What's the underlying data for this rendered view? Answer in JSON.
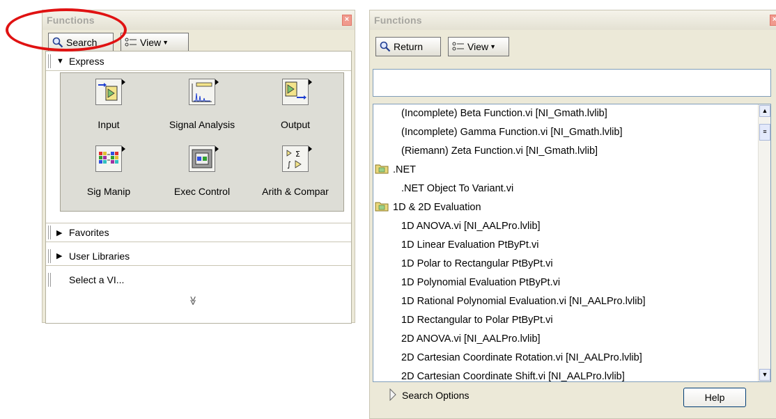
{
  "left_palette": {
    "title": "Functions",
    "search_label": "Search",
    "view_label": "View",
    "categories": [
      {
        "label": "Express",
        "expanded": true
      },
      {
        "label": "Favorites",
        "expanded": false
      },
      {
        "label": "User Libraries",
        "expanded": false
      },
      {
        "label": "Select a VI..."
      }
    ],
    "express_items": [
      {
        "label": "Input",
        "icon": "input-icon"
      },
      {
        "label": "Signal Analysis",
        "icon": "signal-analysis-icon"
      },
      {
        "label": "Output",
        "icon": "output-icon"
      },
      {
        "label": "Sig Manip",
        "icon": "sig-manip-icon"
      },
      {
        "label": "Exec Control",
        "icon": "exec-control-icon"
      },
      {
        "label": "Arith & Compar",
        "icon": "arith-compar-icon"
      }
    ],
    "more_glyph": "≫"
  },
  "right_palette": {
    "title": "Functions",
    "return_label": "Return",
    "view_label": "View",
    "search_value": "",
    "items": [
      {
        "label": "(Incomplete) Beta Function.vi [NI_Gmath.lvlib]",
        "folder": false
      },
      {
        "label": "(Incomplete) Gamma Function.vi [NI_Gmath.lvlib]",
        "folder": false
      },
      {
        "label": "(Riemann) Zeta Function.vi [NI_Gmath.lvlib]",
        "folder": false
      },
      {
        "label": ".NET",
        "folder": true
      },
      {
        "label": ".NET Object To Variant.vi",
        "folder": false
      },
      {
        "label": "1D & 2D Evaluation",
        "folder": true
      },
      {
        "label": "1D ANOVA.vi [NI_AALPro.lvlib]",
        "folder": false
      },
      {
        "label": "1D Linear Evaluation PtByPt.vi",
        "folder": false
      },
      {
        "label": "1D Polar to Rectangular PtByPt.vi",
        "folder": false
      },
      {
        "label": "1D Polynomial Evaluation PtByPt.vi",
        "folder": false
      },
      {
        "label": "1D Rational Polynomial Evaluation.vi [NI_AALPro.lvlib]",
        "folder": false
      },
      {
        "label": "1D Rectangular to Polar PtByPt.vi",
        "folder": false
      },
      {
        "label": "2D ANOVA.vi [NI_AALPro.lvlib]",
        "folder": false
      },
      {
        "label": "2D Cartesian Coordinate Rotation.vi [NI_AALPro.lvlib]",
        "folder": false
      },
      {
        "label": "2D Cartesian Coordinate Shift.vi [NI_AALPro.lvlib]",
        "folder": false
      }
    ],
    "search_options_label": "Search Options",
    "help_label": "Help"
  },
  "colors": {
    "annotation_ring": "#e01212",
    "panel_bg": "#ece9d8"
  }
}
